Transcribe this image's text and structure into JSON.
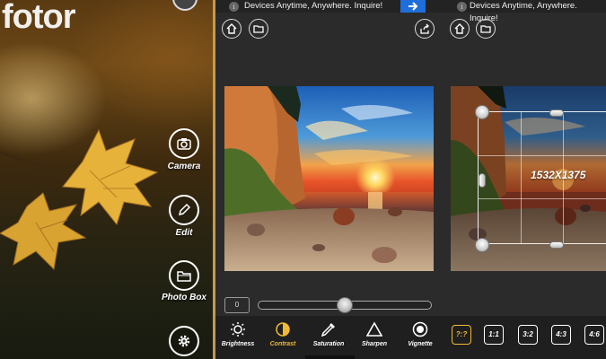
{
  "home": {
    "logo": "fotor",
    "menu": [
      {
        "label": "Camera",
        "icon": "camera-icon"
      },
      {
        "label": "Edit",
        "icon": "pencil-icon"
      },
      {
        "label": "Photo Box",
        "icon": "folder-icon"
      },
      {
        "label": "",
        "icon": "gear-icon"
      }
    ]
  },
  "adjust": {
    "ad_text": "Devices Anytime, Anywhere. Inquire!",
    "ad_info": "i",
    "value": "0",
    "slider_fraction": 0.5,
    "tools": [
      {
        "label": "Brightness",
        "icon": "sun-icon",
        "active": false
      },
      {
        "label": "Contrast",
        "icon": "contrast-icon",
        "active": true
      },
      {
        "label": "Saturation",
        "icon": "dropper-icon",
        "active": false
      },
      {
        "label": "Sharpen",
        "icon": "triangle-icon",
        "active": false
      },
      {
        "label": "Vignette",
        "icon": "vignette-icon",
        "active": false
      }
    ]
  },
  "crop": {
    "ad_text": "Devices Anytime, Anywhere. Inquire!",
    "ad_info": "i",
    "size_label": "1532X1375",
    "ratios": [
      {
        "label": "?:?",
        "active": true
      },
      {
        "label": "1:1",
        "active": false
      },
      {
        "label": "3:2",
        "active": false
      },
      {
        "label": "4:3",
        "active": false
      },
      {
        "label": "4:6",
        "active": false
      }
    ]
  },
  "colors": {
    "accent": "#f1b934",
    "ad_button": "#1e6fd9",
    "toolbar_bg": "#1f1f1f",
    "panel_bg": "#2b2b2b"
  }
}
